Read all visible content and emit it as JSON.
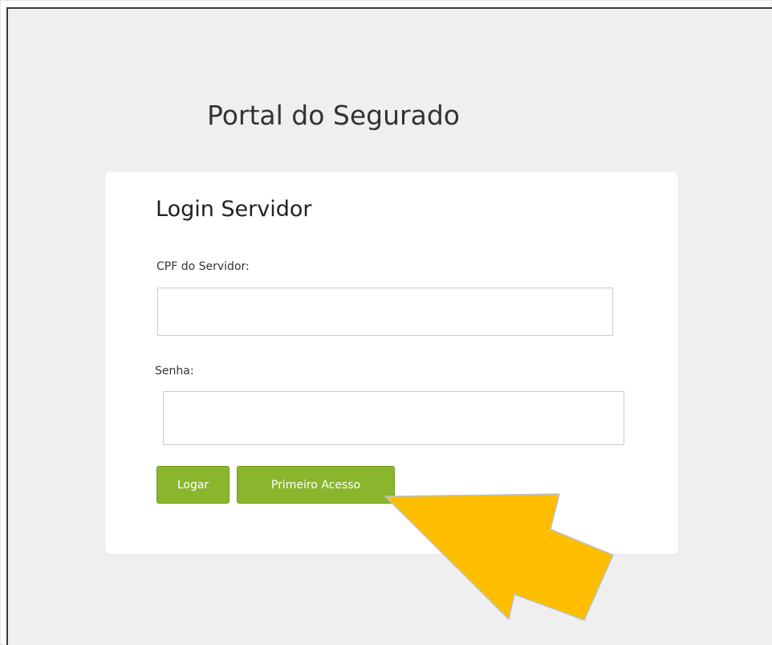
{
  "portal": {
    "title": "Portal do Segurado"
  },
  "login": {
    "title": "Login Servidor",
    "cpf_label": "CPF do Servidor:",
    "cpf_value": "",
    "senha_label": "Senha:",
    "senha_value": "",
    "logar_label": "Logar",
    "primeiro_acesso_label": "Primeiro Acesso"
  },
  "annotation": {
    "arrow_color": "#ffbe00",
    "arrow_outline_color": "#b9c2cf",
    "arrow_icon": "pointer-arrow-icon"
  },
  "colors": {
    "button_green": "#8ab62e",
    "page_background": "#efefef",
    "card_background": "#ffffff"
  }
}
